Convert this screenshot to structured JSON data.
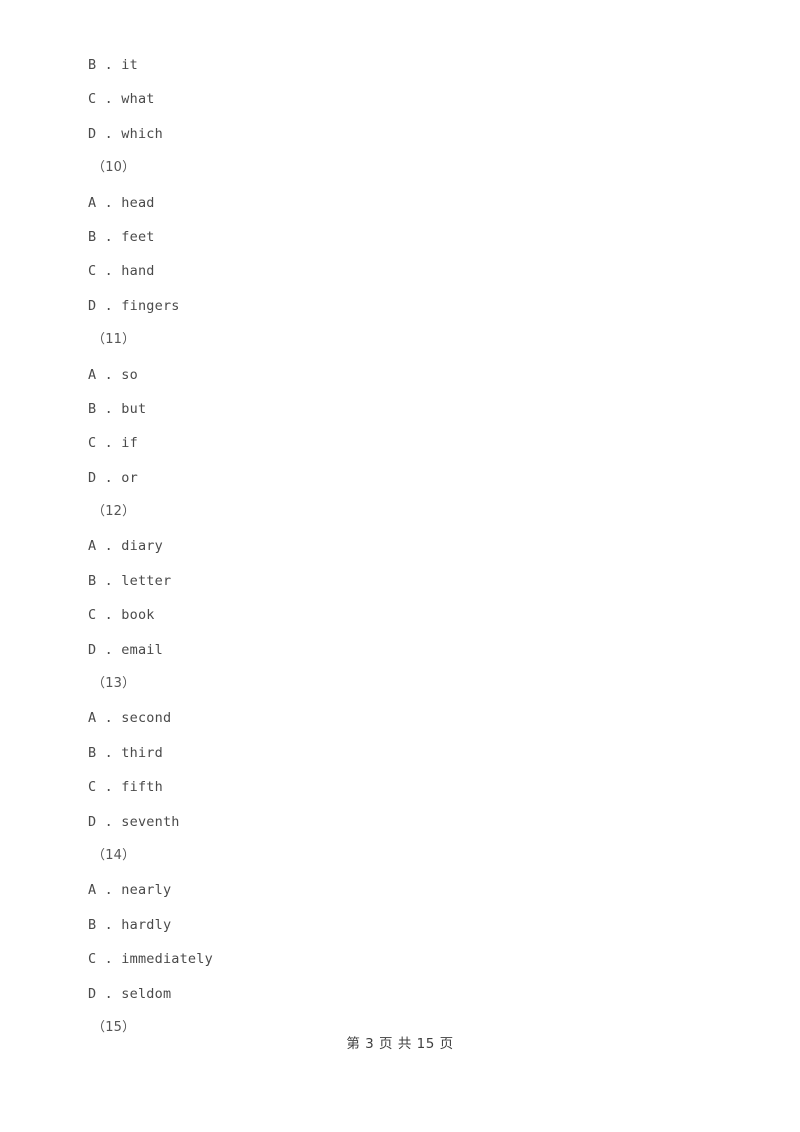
{
  "document": {
    "type": "exam-worksheet",
    "page_background": "#ffffff",
    "text_color": "#4a4a4a"
  },
  "lines": [
    {
      "kind": "option",
      "text": "B . it"
    },
    {
      "kind": "option",
      "text": "C . what"
    },
    {
      "kind": "option",
      "text": "D . which"
    },
    {
      "kind": "qnum",
      "text": "（10）"
    },
    {
      "kind": "option",
      "text": "A . head"
    },
    {
      "kind": "option",
      "text": "B . feet"
    },
    {
      "kind": "option",
      "text": "C . hand"
    },
    {
      "kind": "option",
      "text": "D . fingers"
    },
    {
      "kind": "qnum",
      "text": "（11）"
    },
    {
      "kind": "option",
      "text": "A . so"
    },
    {
      "kind": "option",
      "text": "B . but"
    },
    {
      "kind": "option",
      "text": "C . if"
    },
    {
      "kind": "option",
      "text": "D . or"
    },
    {
      "kind": "qnum",
      "text": "（12）"
    },
    {
      "kind": "option",
      "text": "A . diary"
    },
    {
      "kind": "option",
      "text": "B . letter"
    },
    {
      "kind": "option",
      "text": "C . book"
    },
    {
      "kind": "option",
      "text": "D . email"
    },
    {
      "kind": "qnum",
      "text": "（13）"
    },
    {
      "kind": "option",
      "text": "A . second"
    },
    {
      "kind": "option",
      "text": "B . third"
    },
    {
      "kind": "option",
      "text": "C . fifth"
    },
    {
      "kind": "option",
      "text": "D . seventh"
    },
    {
      "kind": "qnum",
      "text": "（14）"
    },
    {
      "kind": "option",
      "text": "A . nearly"
    },
    {
      "kind": "option",
      "text": "B . hardly"
    },
    {
      "kind": "option",
      "text": "C . immediately"
    },
    {
      "kind": "option",
      "text": "D . seldom"
    },
    {
      "kind": "qnum",
      "text": "（15）"
    }
  ],
  "footer": {
    "text": "第 3 页 共 15 页",
    "current_page": "3",
    "total_pages": "15"
  }
}
